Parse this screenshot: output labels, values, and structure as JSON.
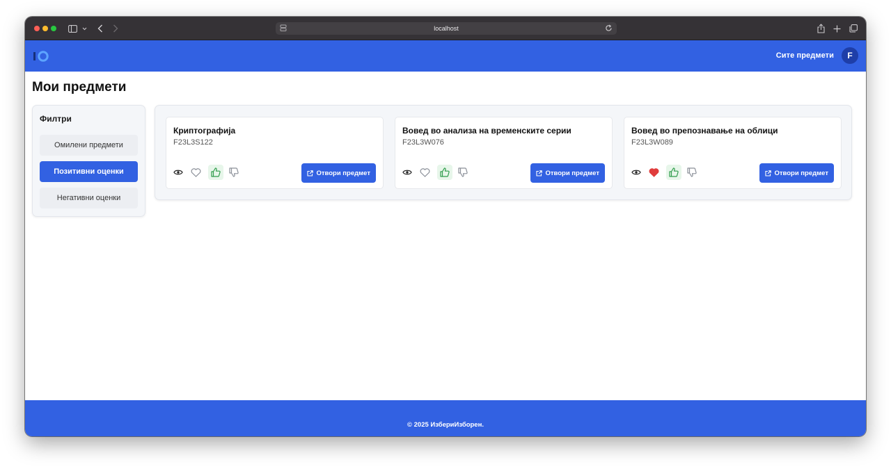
{
  "browser": {
    "url": "localhost",
    "icons": [
      "sidebar-toggle-icon",
      "chevron-down-icon",
      "back-icon",
      "forward-icon",
      "site-settings-icon",
      "reload-icon",
      "share-icon",
      "new-tab-icon",
      "tabs-overview-icon"
    ]
  },
  "header": {
    "nav_link": "Сите предмети",
    "avatar_letter": "F",
    "brand_color": "#3261e2"
  },
  "page": {
    "title": "Мои предмети"
  },
  "filters": {
    "title": "Филтри",
    "options": [
      {
        "label": "Омилени предмети",
        "active": false
      },
      {
        "label": "Позитивни оценки",
        "active": true
      },
      {
        "label": "Негативни оценки",
        "active": false
      }
    ]
  },
  "courses": [
    {
      "title": "Криптографија",
      "code": "F23L3S122",
      "favorite": false,
      "liked": true,
      "open_label": "Отвори предмет"
    },
    {
      "title": "Вовед во анализа на временските серии",
      "code": "F23L3W076",
      "favorite": false,
      "liked": true,
      "open_label": "Отвори предмет"
    },
    {
      "title": "Вовед во препознавање на облици",
      "code": "F23L3W089",
      "favorite": true,
      "liked": true,
      "open_label": "Отвори предмет"
    }
  ],
  "footer": {
    "text": "© 2025 ИзбериИзборен."
  },
  "colors": {
    "accent": "#3261e2",
    "like": "#2e9c4a",
    "favorite": "#e03c3c"
  }
}
